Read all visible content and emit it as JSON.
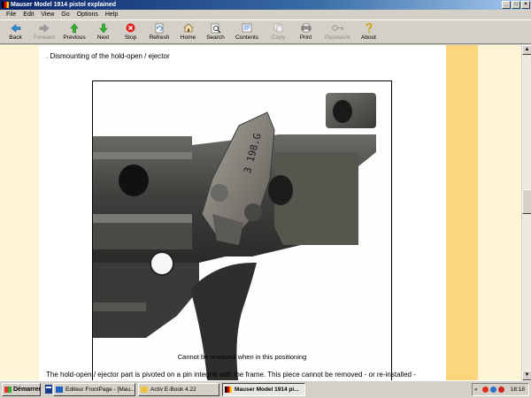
{
  "window": {
    "title": "Mauser Model 1914 pistol explained"
  },
  "menu": [
    "File",
    "Edit",
    "View",
    "Go",
    "Options",
    "Help"
  ],
  "toolbar": [
    {
      "label": "Back",
      "icon": "back-arrow-icon",
      "enabled": true
    },
    {
      "label": "Forward",
      "icon": "forward-arrow-icon",
      "enabled": false
    },
    {
      "label": "Previous",
      "icon": "up-arrow-icon",
      "enabled": true
    },
    {
      "label": "Next",
      "icon": "down-arrow-icon",
      "enabled": true
    },
    {
      "label": "Stop",
      "icon": "stop-icon",
      "enabled": true
    },
    {
      "label": "Refresh",
      "icon": "refresh-icon",
      "enabled": true
    },
    {
      "label": "Home",
      "icon": "home-icon",
      "enabled": true
    },
    {
      "label": "Search",
      "icon": "search-icon",
      "enabled": true
    },
    {
      "label": "Contents",
      "icon": "contents-icon",
      "enabled": true
    },
    {
      "label": "Copy",
      "icon": "copy-icon",
      "enabled": false
    },
    {
      "label": "Print",
      "icon": "print-icon",
      "enabled": true
    },
    {
      "label": "Password",
      "icon": "key-icon",
      "enabled": false
    },
    {
      "label": "About",
      "icon": "about-icon",
      "enabled": true
    }
  ],
  "page": {
    "heading": ". Dismounting of the hold-open / ejector",
    "image_stamp": "3 198.G",
    "caption": "Cannot be removed when in this positioning",
    "body": "The  hold-open / ejector part is pivoted on a pin integral with the frame. This piece cannot be removed - or re-installed -"
  },
  "taskbar": {
    "start": "Démarrer",
    "tasks": [
      {
        "label": "Editeur FrontPage - [Mau...",
        "active": false
      },
      {
        "label": "Activ E-Book 4.22",
        "active": false
      },
      {
        "label": "Mauser Model 1914 pi...",
        "active": true
      }
    ],
    "clock": "18:18"
  },
  "colors": {
    "page_bg": "#ffffff",
    "left_margin": "#fdf5d5",
    "right_band": "#fcd67c",
    "title_bar": "#0a246a"
  }
}
